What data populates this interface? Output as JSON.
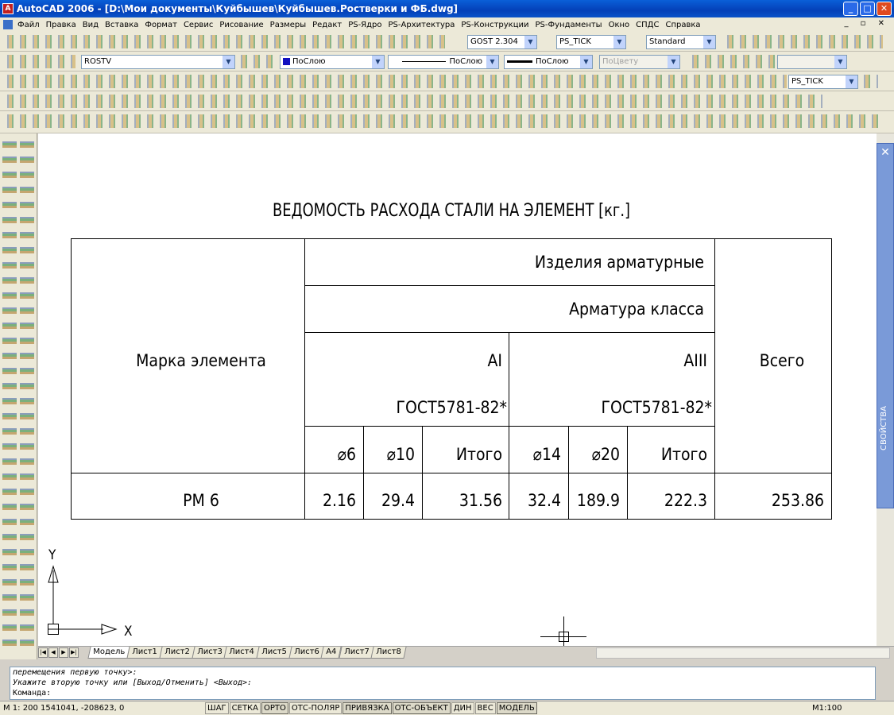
{
  "window": {
    "title": "AutoCAD 2006 - [D:\\Мои документы\\Куйбышев\\Куйбышев.Ростверки и ФБ.dwg]"
  },
  "menu": [
    "Файл",
    "Правка",
    "Вид",
    "Вставка",
    "Формат",
    "Сервис",
    "Рисование",
    "Размеры",
    "Редакт",
    "PS-Ядро",
    "PS-Архитектура",
    "PS-Конструкции",
    "PS-Фундаменты",
    "Окно",
    "СПДС",
    "Справка"
  ],
  "toolbars": {
    "text_style": "GOST 2.304",
    "dim_style": "PS_TICK",
    "table_style": "Standard",
    "layer": "ROSTV",
    "color": "ПоСлою",
    "linetype": "ПоСлою",
    "lineweight": "ПоСлою",
    "plotstyle": "ПоЦвету",
    "dim_style_2": "PS_TICK"
  },
  "sheet": {
    "title": "ВЕДОМОСТЬ РАСХОДА СТАЛИ НА ЭЛЕМЕНТ [кг.]",
    "h_mark": "Марка элемента",
    "h_products": "Изделия арматурные",
    "h_class": "Арматура класса",
    "h_total": "Всего",
    "cls_a1": "AI",
    "cls_a3": "AIII",
    "gost_a1": "ГОСТ5781-82*",
    "gost_a3": "ГОСТ5781-82*",
    "d6": "⌀6",
    "d10": "⌀10",
    "sum1": "Итого",
    "d14": "⌀14",
    "d20": "⌀20",
    "sum2": "Итого",
    "row": {
      "mark": "РМ 6",
      "v6": "2.16",
      "v10": "29.4",
      "itogo1": "31.56",
      "v14": "32.4",
      "v20": "189.9",
      "itogo2": "222.3",
      "total": "253.86"
    },
    "ucs_x": "X",
    "ucs_y": "Y"
  },
  "tabs": [
    "Модель",
    "Лист1",
    "Лист2",
    "Лист3",
    "Лист4",
    "Лист5",
    "Лист6",
    "А4",
    "Лист7",
    "Лист8"
  ],
  "command": {
    "line1": "перемещения первую точку>:",
    "line2": "Укажите вторую точку или [Выход/Отменить] <Выход>:",
    "line3": "Команда:"
  },
  "status": {
    "coords": "М 1: 200  1541041, -208623, 0",
    "buttons": [
      "ШАГ",
      "СЕТКА",
      "ОРТО",
      "ОТС-ПОЛЯР",
      "ПРИВЯЗКА",
      "ОТС-ОБЪЕКТ",
      "ДИН",
      "ВЕС",
      "МОДЕЛЬ"
    ],
    "scale": "М1:100"
  },
  "properties_panel": {
    "label": "СВОЙСТВА"
  }
}
